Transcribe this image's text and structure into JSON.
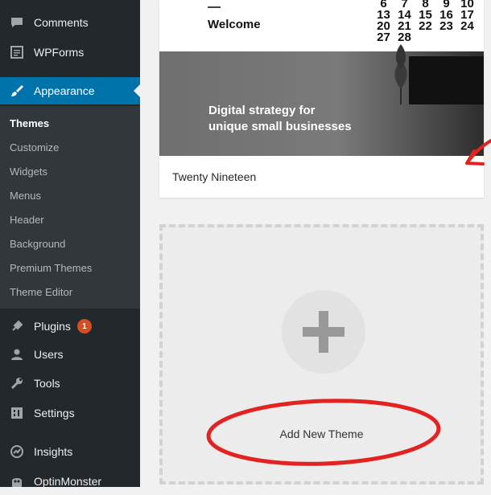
{
  "sidebar": {
    "menu": [
      {
        "label": "Comments",
        "icon": "comments-icon"
      },
      {
        "label": "WPForms",
        "icon": "wpforms-icon"
      },
      {
        "label": "Appearance",
        "icon": "appearance-brush-icon",
        "active": true
      }
    ],
    "submenu": [
      "Themes",
      "Customize",
      "Widgets",
      "Menus",
      "Header",
      "Background",
      "Premium Themes",
      "Theme Editor"
    ],
    "current_submenu": "Themes",
    "menu_after": [
      {
        "label": "Plugins",
        "icon": "plugins-icon",
        "badge": "1"
      },
      {
        "label": "Users",
        "icon": "users-icon"
      },
      {
        "label": "Tools",
        "icon": "tools-icon"
      },
      {
        "label": "Settings",
        "icon": "settings-icon"
      },
      {
        "label": "Insights",
        "icon": "insights-icon"
      },
      {
        "label": "OptinMonster",
        "icon": "optinmonster-icon"
      }
    ]
  },
  "theme_card": {
    "preview_welcome": "Welcome",
    "preview_headline_line1": "Digital strategy for",
    "preview_headline_line2": "unique small businesses",
    "preview_calendar": [
      "6",
      "7",
      "8",
      "9",
      "10",
      "13",
      "14",
      "15",
      "16",
      "17",
      "20",
      "21",
      "22",
      "23",
      "24",
      "27",
      "28"
    ],
    "name": "Twenty Nineteen"
  },
  "add_new": {
    "label": "Add New Theme",
    "icon": "plus-icon"
  },
  "annotations": {
    "color": "#e32222",
    "circle_target": "Add New Theme",
    "arrow_target": "Twenty Nineteen"
  },
  "colors": {
    "sidebar_bg": "#23282d",
    "submenu_bg": "#32373c",
    "active_bg": "#0073aa",
    "badge_bg": "#d54e21"
  }
}
